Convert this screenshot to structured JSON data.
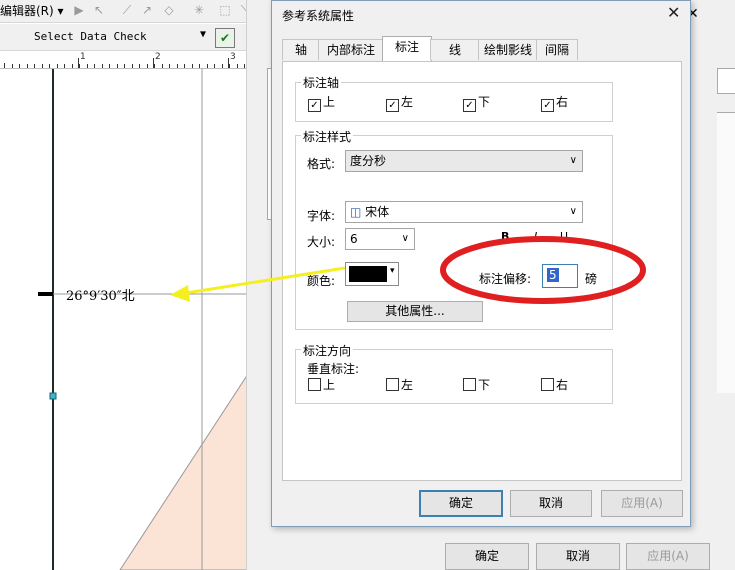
{
  "background": {
    "menu_editor": "编辑器(R)",
    "data_check_select": "Select Data Check",
    "ruler_labels": [
      "1",
      "2",
      "3"
    ],
    "map_label": "26°9′30″北",
    "ok_label": "确定",
    "cancel_label": "取消",
    "apply_label": "应用(A)"
  },
  "dialog": {
    "title": "参考系统属性",
    "tabs": [
      {
        "label": "轴"
      },
      {
        "label": "内部标注"
      },
      {
        "label": "标注"
      },
      {
        "label": "线"
      },
      {
        "label": "绘制影线"
      },
      {
        "label": "间隔"
      }
    ],
    "label_axes": {
      "title": "标注轴",
      "items": [
        {
          "label": "上",
          "checked": true
        },
        {
          "label": "左",
          "checked": true
        },
        {
          "label": "下",
          "checked": true
        },
        {
          "label": "右",
          "checked": true
        }
      ]
    },
    "label_style": {
      "title": "标注样式",
      "format_label": "格式:",
      "format_value": "度分秒",
      "font_label": "字体:",
      "font_value": "宋体",
      "size_label": "大小:",
      "size_value": "6",
      "bold": "B",
      "italic": "I",
      "underline": "U",
      "color_label": "颜色:",
      "color_value": "#000000",
      "offset_label": "标注偏移:",
      "offset_value": "5",
      "offset_unit": "磅",
      "more_props_button": "其他属性..."
    },
    "label_direction": {
      "title": "标注方向",
      "vertical_label": "垂直标注:",
      "items": [
        {
          "label": "上",
          "checked": false
        },
        {
          "label": "左",
          "checked": false
        },
        {
          "label": "下",
          "checked": false
        },
        {
          "label": "右",
          "checked": false
        }
      ]
    },
    "buttons": {
      "ok": "确定",
      "cancel": "取消",
      "apply": "应用(A)"
    }
  },
  "colors": {
    "highlight_ellipse": "#e02020",
    "arrow": "#f5ef22",
    "map_polygon": "#fbe3d6",
    "default_button_border": "#3c7fb1"
  }
}
